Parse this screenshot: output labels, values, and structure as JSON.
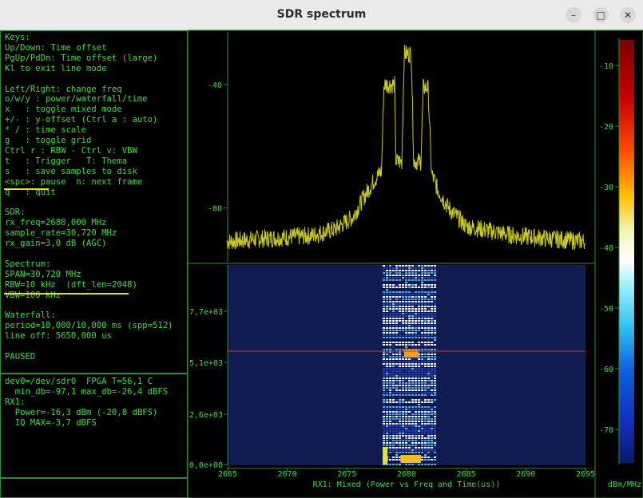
{
  "window": {
    "title": "SDR spectrum",
    "buttons": [
      "–",
      "□",
      "✕"
    ]
  },
  "keys_lines": [
    "Keys:",
    "Up/Down: Time offset",
    "PgUp/PdDn: Time offset (large)",
    "Kl to exit line mode",
    "",
    "Left/Right: change freq",
    "o/w/y : power/waterfall/time",
    "x   : toggle mixed mode",
    "+/- : y-offset (Ctrl a : auto)",
    "* / : time scale",
    "g   : toggle grid",
    "Ctrl r : RBW - Ctrl v: VBW",
    "t   : Trigger   T: Thema",
    "s   : save samples to disk",
    "<spc>: pause  n: next frame",
    "q   : quit",
    "",
    "SDR:",
    "rx_freq=2680,000 MHz",
    "sample_rate=30,720 MHz",
    "rx_gain=3,0 dB (AGC)",
    "",
    "Spectrum:",
    "SPAN=30,720 MHz",
    "RBW=10 kHz  (dft_len=2048)",
    "VBW=100 kHz",
    "",
    "Waterfall:",
    "period=10,000/10,000 ms (spp=512)",
    "line off: 5650,000 us",
    "",
    "PAUSED"
  ],
  "status_lines": [
    "dev0=/dev/sdr0  FPGA T=56,1 C",
    "  min_db=-97,1 max_db=-26,4 dBFS",
    "RX1:",
    "  Power=-16,3 dBm (-20,8 dBFS)",
    "  IQ MAX=-3,7 dBFS"
  ],
  "spectrum": {
    "y_ticks": [
      "-40",
      "-80"
    ],
    "trace_color": "#c8c81e"
  },
  "waterfall": {
    "y_ticks": [
      "7,7e+03",
      "5,1e+03",
      "2,6e+03",
      "0,0e+00"
    ],
    "x_ticks": [
      "2665",
      "2670",
      "2675",
      "2680",
      "2685",
      "2690",
      "2695"
    ],
    "x_label": "RX1: Mixed (Power vs Freq and Time(us))",
    "background": "#101c50",
    "marker_color": "#c83232"
  },
  "colorbar": {
    "ticks": [
      "-10",
      "-20",
      "-30",
      "-40",
      "-50",
      "-60",
      "-70"
    ],
    "unit": "dBm/MHz"
  },
  "chart_data": {
    "type": "line",
    "title": "",
    "xlabel": "RX1: Mixed (Power vs Freq and Time(us))",
    "ylabel": "",
    "x_unit": "MHz",
    "xlim": [
      2664.6,
      2695.4
    ],
    "ylim_spectrum": [
      -97,
      -26
    ],
    "series": [
      {
        "x": [
          2664.8,
          2668,
          2672,
          2674,
          2675.5,
          2676.5,
          2677.3,
          2677.9,
          2678.1,
          2679.0,
          2679.1,
          2679.6,
          2679.8,
          2680.4,
          2680.6,
          2681.2,
          2681.4,
          2681.8,
          2682.1,
          2682.6,
          2683.5,
          2685,
          2689,
          2692,
          2695.3
        ],
        "y": [
          -91,
          -90,
          -89,
          -87,
          -83,
          -76,
          -71,
          -68,
          -40,
          -40,
          -65,
          -65,
          -30,
          -30,
          -65,
          -65,
          -41,
          -41,
          -69,
          -74,
          -80,
          -86,
          -89,
          -90,
          -91
        ]
      }
    ],
    "waterfall_y_ticks": [
      "7,7e+03",
      "5,1e+03",
      "2,6e+03",
      "0,0e+00"
    ],
    "marker_time_us": 5650
  }
}
